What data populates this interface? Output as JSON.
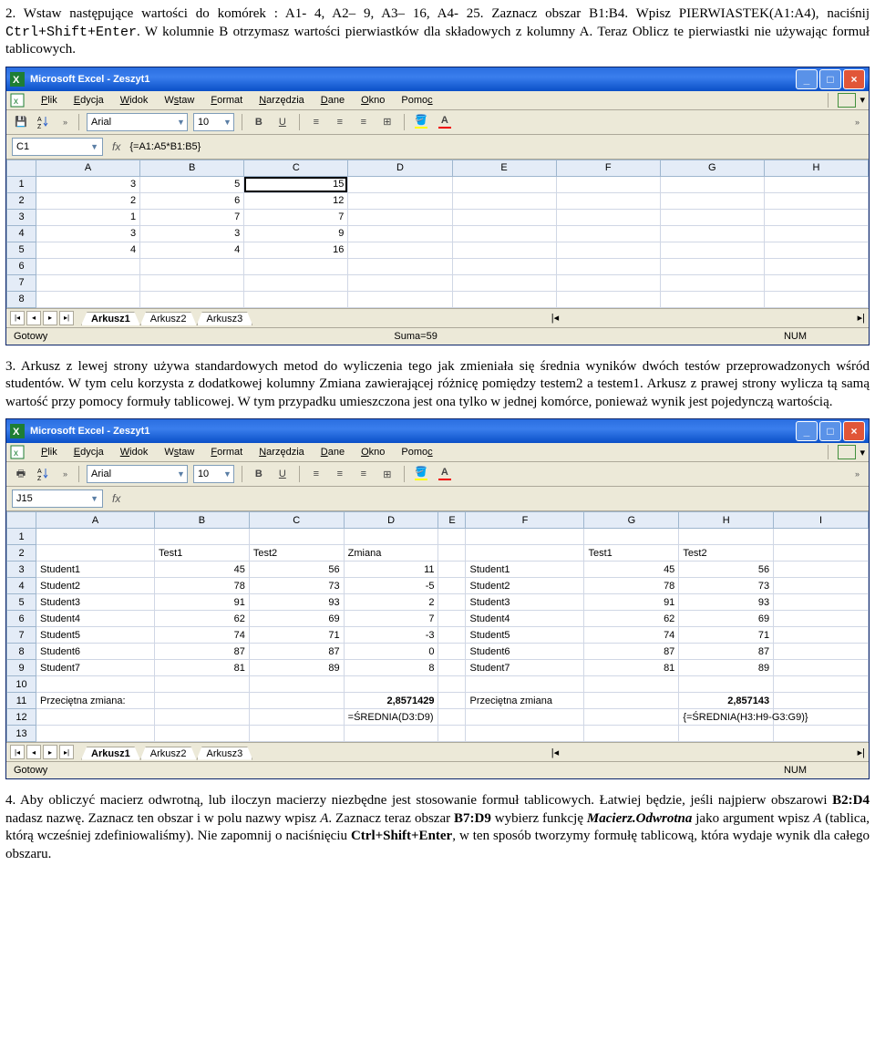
{
  "para1_a": "2. Wstaw następujące wartości do komórek : A1- 4, A2– 9, A3– 16, A4- 25. Zaznacz obszar B1:B4. Wpisz PIERWIASTEK(A1:A4), naciśnij ",
  "para1_b": "Ctrl+Shift+Enter",
  "para1_c": ". W kolumnie B otrzymasz wartości pierwiastków dla składowych z kolumny A. Teraz Oblicz te pierwiastki nie używając formuł tablicowych.",
  "para2": "3. Arkusz z lewej strony używa standardowych metod do wyliczenia tego jak zmieniała się średnia wyników dwóch testów przeprowadzonych wśród studentów. W tym celu korzysta z dodatkowej kolumny Zmiana zawierającej różnicę pomiędzy testem2 a testem1. Arkusz z prawej strony wylicza tą samą wartość przy pomocy formuły tablicowej. W tym przypadku umieszczona jest ona tylko w jednej komórce, ponieważ wynik jest pojedynczą wartością.",
  "para3_a": "4. Aby obliczyć macierz odwrotną, lub iloczyn macierzy niezbędne jest stosowanie formuł tablicowych. Łatwiej będzie, jeśli najpierw obszarowi ",
  "para3_b": "B2:D4",
  "para3_c": " nadasz nazwę. Zaznacz ten obszar i w polu nazwy wpisz ",
  "para3_d": "A",
  "para3_e": ". Zaznacz teraz obszar ",
  "para3_f": "B7:D9",
  "para3_g": " wybierz funkcję ",
  "para3_h": "Macierz.Odwrotna",
  "para3_i": " jako argument wpisz ",
  "para3_j": "A",
  "para3_k": " (tablica, którą wcześniej zdefiniowaliśmy). Nie zapomnij o naciśnięciu ",
  "para3_l": "Ctrl+Shift+Enter",
  "para3_m": ", w ten sposób tworzymy formułę tablicową, która wydaje wynik dla całego obszaru.",
  "app": {
    "title": "Microsoft Excel - Zeszyt1",
    "menu": [
      "Plik",
      "Edycja",
      "Widok",
      "Wstaw",
      "Format",
      "Narzędzia",
      "Dane",
      "Okno",
      "Pomoc"
    ],
    "font": "Arial",
    "size": "10",
    "status_ready": "Gotowy",
    "num": "NUM",
    "sheets": [
      "Arkusz1",
      "Arkusz2",
      "Arkusz3"
    ]
  },
  "excel1": {
    "namebox": "C1",
    "formula": "{=A1:A5*B1:B5}",
    "status_sum": "Suma=59",
    "cols": [
      "A",
      "B",
      "C",
      "D",
      "E",
      "F",
      "G",
      "H"
    ],
    "rows": [
      "1",
      "2",
      "3",
      "4",
      "5",
      "6",
      "7",
      "8"
    ],
    "data": {
      "A": [
        "3",
        "2",
        "1",
        "3",
        "4",
        "",
        "",
        ""
      ],
      "B": [
        "5",
        "6",
        "7",
        "3",
        "4",
        "",
        "",
        ""
      ],
      "C": [
        "15",
        "12",
        "7",
        "9",
        "16",
        "",
        "",
        ""
      ]
    }
  },
  "excel2": {
    "namebox": "J15",
    "formula": "",
    "cols": [
      "A",
      "B",
      "C",
      "D",
      "E",
      "F",
      "G",
      "H",
      "I"
    ],
    "rows": [
      "1",
      "2",
      "3",
      "4",
      "5",
      "6",
      "7",
      "8",
      "9",
      "10",
      "11",
      "12",
      "13"
    ],
    "r2": {
      "B": "Test1",
      "C": "Test2",
      "D": "Zmiana",
      "G": "Test1",
      "H": "Test2"
    },
    "r3": {
      "A": "Student1",
      "B": "45",
      "C": "56",
      "D": "11",
      "F": "Student1",
      "G": "45",
      "H": "56"
    },
    "r4": {
      "A": "Student2",
      "B": "78",
      "C": "73",
      "D": "-5",
      "F": "Student2",
      "G": "78",
      "H": "73"
    },
    "r5": {
      "A": "Student3",
      "B": "91",
      "C": "93",
      "D": "2",
      "F": "Student3",
      "G": "91",
      "H": "93"
    },
    "r6": {
      "A": "Student4",
      "B": "62",
      "C": "69",
      "D": "7",
      "F": "Student4",
      "G": "62",
      "H": "69"
    },
    "r7": {
      "A": "Student5",
      "B": "74",
      "C": "71",
      "D": "-3",
      "F": "Student5",
      "G": "74",
      "H": "71"
    },
    "r8": {
      "A": "Student6",
      "B": "87",
      "C": "87",
      "D": "0",
      "F": "Student6",
      "G": "87",
      "H": "87"
    },
    "r9": {
      "A": "Student7",
      "B": "81",
      "C": "89",
      "D": "8",
      "F": "Student7",
      "G": "81",
      "H": "89"
    },
    "r11": {
      "A": "Przeciętna zmiana:",
      "D": "2,8571429",
      "F": "Przeciętna zmiana",
      "H": "2,857143"
    },
    "r12": {
      "D": "=ŚREDNIA(D3:D9)",
      "H": "{=ŚREDNIA(H3:H9-G3:G9)}"
    }
  }
}
